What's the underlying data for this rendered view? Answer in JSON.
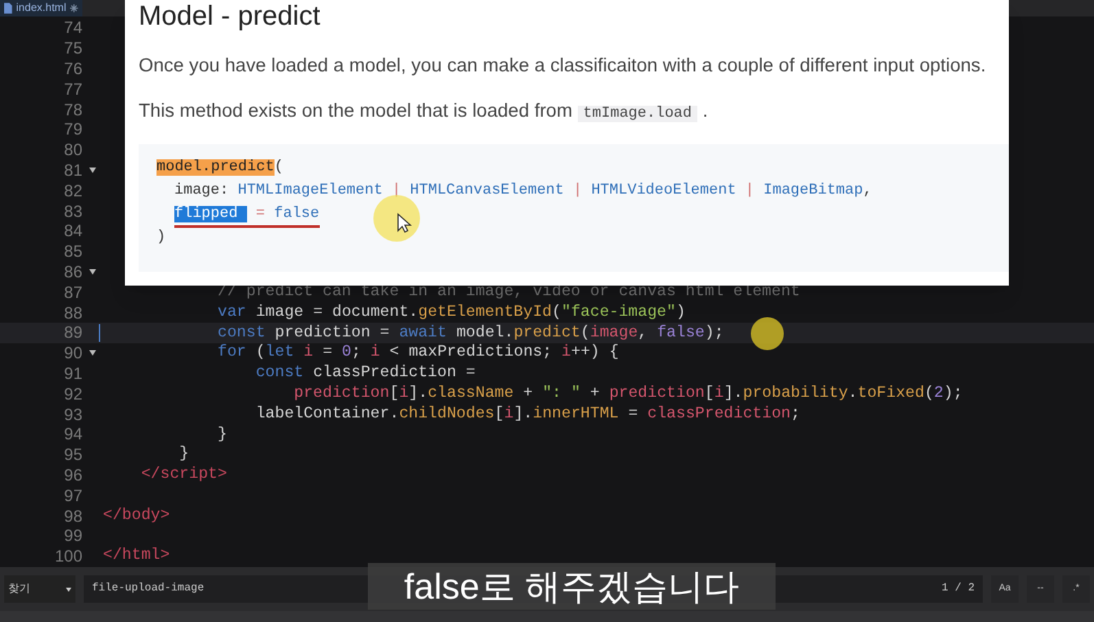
{
  "tab": {
    "label": "index.html",
    "modified": true
  },
  "editor": {
    "lines": [
      {
        "number": "74",
        "fold": false,
        "current": false
      },
      {
        "number": "75",
        "fold": false,
        "current": false
      },
      {
        "number": "76",
        "fold": false,
        "current": false
      },
      {
        "number": "77",
        "fold": false,
        "current": false
      },
      {
        "number": "78",
        "fold": false,
        "current": false
      },
      {
        "number": "79",
        "fold": false,
        "current": false
      },
      {
        "number": "80",
        "fold": false,
        "current": false
      },
      {
        "number": "81",
        "fold": true,
        "current": false
      },
      {
        "number": "82",
        "fold": false,
        "current": false
      },
      {
        "number": "83",
        "fold": false,
        "current": false
      },
      {
        "number": "84",
        "fold": false,
        "current": false
      },
      {
        "number": "85",
        "fold": false,
        "current": false
      },
      {
        "number": "86",
        "fold": true,
        "current": false
      },
      {
        "number": "87",
        "fold": false,
        "current": false,
        "tokens": [
          {
            "kind": "comment",
            "text": "            // predict can take in an image, video or canvas html element"
          }
        ]
      },
      {
        "number": "88",
        "fold": false,
        "current": false,
        "tokens": [
          {
            "kind": "keyword",
            "text": "            var"
          },
          {
            "kind": "plain",
            "text": " image = document."
          },
          {
            "kind": "func",
            "text": "getElementById"
          },
          {
            "kind": "plain",
            "text": "("
          },
          {
            "kind": "string",
            "text": "\"face-image\""
          },
          {
            "kind": "plain",
            "text": ")"
          }
        ]
      },
      {
        "number": "89",
        "fold": false,
        "current": true,
        "tokens": [
          {
            "kind": "keyword",
            "text": "            const"
          },
          {
            "kind": "plain",
            "text": " prediction = "
          },
          {
            "kind": "keyword",
            "text": "await"
          },
          {
            "kind": "plain",
            "text": " model."
          },
          {
            "kind": "func",
            "text": "predict"
          },
          {
            "kind": "plain",
            "text": "("
          },
          {
            "kind": "var",
            "text": "image"
          },
          {
            "kind": "plain",
            "text": ", "
          },
          {
            "kind": "number",
            "text": "false"
          },
          {
            "kind": "plain",
            "text": ");"
          }
        ]
      },
      {
        "number": "90",
        "fold": true,
        "current": false,
        "tokens": [
          {
            "kind": "keyword",
            "text": "            for"
          },
          {
            "kind": "plain",
            "text": " ("
          },
          {
            "kind": "keyword",
            "text": "let "
          },
          {
            "kind": "var",
            "text": "i"
          },
          {
            "kind": "plain",
            "text": " = "
          },
          {
            "kind": "number",
            "text": "0"
          },
          {
            "kind": "plain",
            "text": "; "
          },
          {
            "kind": "var",
            "text": "i"
          },
          {
            "kind": "plain",
            "text": " < maxPredictions; "
          },
          {
            "kind": "var",
            "text": "i"
          },
          {
            "kind": "plain",
            "text": "++) {"
          }
        ]
      },
      {
        "number": "91",
        "fold": false,
        "current": false,
        "tokens": [
          {
            "kind": "keyword",
            "text": "                const"
          },
          {
            "kind": "plain",
            "text": " classPrediction ="
          }
        ]
      },
      {
        "number": "92",
        "fold": false,
        "current": false,
        "tokens": [
          {
            "kind": "var",
            "text": "                    prediction"
          },
          {
            "kind": "plain",
            "text": "["
          },
          {
            "kind": "var",
            "text": "i"
          },
          {
            "kind": "plain",
            "text": "]."
          },
          {
            "kind": "func",
            "text": "className"
          },
          {
            "kind": "plain",
            "text": " + "
          },
          {
            "kind": "string",
            "text": "\": \""
          },
          {
            "kind": "plain",
            "text": " + "
          },
          {
            "kind": "var",
            "text": "prediction"
          },
          {
            "kind": "plain",
            "text": "["
          },
          {
            "kind": "var",
            "text": "i"
          },
          {
            "kind": "plain",
            "text": "]."
          },
          {
            "kind": "func",
            "text": "probability"
          },
          {
            "kind": "plain",
            "text": "."
          },
          {
            "kind": "func",
            "text": "toFixed"
          },
          {
            "kind": "plain",
            "text": "("
          },
          {
            "kind": "number",
            "text": "2"
          },
          {
            "kind": "plain",
            "text": ");"
          }
        ]
      },
      {
        "number": "93",
        "fold": false,
        "current": false,
        "tokens": [
          {
            "kind": "plain",
            "text": "                labelContainer."
          },
          {
            "kind": "func",
            "text": "childNodes"
          },
          {
            "kind": "plain",
            "text": "["
          },
          {
            "kind": "var",
            "text": "i"
          },
          {
            "kind": "plain",
            "text": "]."
          },
          {
            "kind": "func",
            "text": "innerHTML"
          },
          {
            "kind": "plain",
            "text": " = "
          },
          {
            "kind": "var",
            "text": "classPrediction"
          },
          {
            "kind": "plain",
            "text": ";"
          }
        ]
      },
      {
        "number": "94",
        "fold": false,
        "current": false,
        "tokens": [
          {
            "kind": "plain",
            "text": "            }"
          }
        ]
      },
      {
        "number": "95",
        "fold": false,
        "current": false,
        "tokens": [
          {
            "kind": "plain",
            "text": "        }"
          }
        ]
      },
      {
        "number": "96",
        "fold": false,
        "current": false,
        "tokens": [
          {
            "kind": "tag",
            "text": "    </script>"
          }
        ]
      },
      {
        "number": "97",
        "fold": false,
        "current": false
      },
      {
        "number": "98",
        "fold": false,
        "current": false,
        "tokens": [
          {
            "kind": "tag",
            "text": "</body>"
          }
        ]
      },
      {
        "number": "99",
        "fold": false,
        "current": false
      },
      {
        "number": "100",
        "fold": false,
        "current": false,
        "tokens": [
          {
            "kind": "tag",
            "text": "</html>"
          }
        ]
      }
    ]
  },
  "doc_popup": {
    "title": "Model - predict",
    "paragraphs": [
      {
        "parts": [
          {
            "kind": "text",
            "text": "Once you have loaded a model, you can make a classificaiton with a couple of different input options."
          }
        ]
      },
      {
        "parts": [
          {
            "kind": "text",
            "text": "This method exists on the model that is loaded from "
          },
          {
            "kind": "code",
            "text": "tmImage.load"
          },
          {
            "kind": "text",
            "text": " ."
          }
        ]
      }
    ],
    "code_lines": [
      {
        "indented": false,
        "underlined": false,
        "tokens": [
          {
            "kind": "highlight-orange",
            "text": "model.predict"
          },
          {
            "kind": "plain",
            "text": "("
          }
        ]
      },
      {
        "indented": true,
        "underlined": false,
        "tokens": [
          {
            "kind": "plain",
            "text": "image: "
          },
          {
            "kind": "type",
            "text": "HTMLImageElement"
          },
          {
            "kind": "sep",
            "text": " | "
          },
          {
            "kind": "type",
            "text": "HTMLCanvasElement"
          },
          {
            "kind": "sep",
            "text": " | "
          },
          {
            "kind": "type",
            "text": "HTMLVideoElement"
          },
          {
            "kind": "sep",
            "text": " | "
          },
          {
            "kind": "type",
            "text": "ImageBitmap"
          },
          {
            "kind": "plain",
            "text": ","
          }
        ]
      },
      {
        "indented": true,
        "underlined": true,
        "tokens": [
          {
            "kind": "highlight-blue",
            "text": "flipped "
          },
          {
            "kind": "sep",
            "text": " = "
          },
          {
            "kind": "type",
            "text": "false"
          }
        ]
      },
      {
        "indented": false,
        "underlined": false,
        "tokens": [
          {
            "kind": "plain",
            "text": ")"
          }
        ]
      }
    ]
  },
  "find_bar": {
    "mode": "찾기",
    "query": "file-upload-image",
    "count": "1 / 2",
    "options": [
      "Aa",
      "--",
      ".*"
    ]
  },
  "subtitle": "false로 해주겠습니다"
}
